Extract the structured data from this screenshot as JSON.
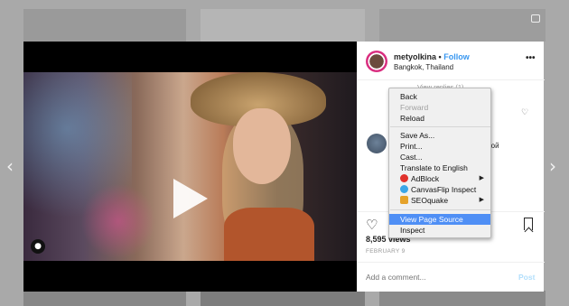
{
  "modal": {
    "username": "metyolkina",
    "separator": "•",
    "follow_label": "Follow",
    "location": "Bangkok, Thailand",
    "more_label": "•••",
    "view_replies": "View replies (1)",
    "partial_comment_line1": "и",
    "partial_comment_line2": "дой",
    "views": "8,595 views",
    "date": "FEBRUARY 9",
    "comment_placeholder": "Add a comment...",
    "post_label": "Post"
  },
  "nav": {
    "prev": "‹",
    "next": "›"
  },
  "context_menu": {
    "items": [
      {
        "label": "Back",
        "disabled": false
      },
      {
        "label": "Forward",
        "disabled": true
      },
      {
        "label": "Reload",
        "disabled": false
      },
      {
        "label": "Save As...",
        "disabled": false
      },
      {
        "label": "Print...",
        "disabled": false
      },
      {
        "label": "Cast...",
        "disabled": false
      },
      {
        "label": "Translate to English",
        "disabled": false
      },
      {
        "label": "AdBlock",
        "icon": "adblock-icon",
        "submenu": true
      },
      {
        "label": "CanvasFlip Inspect",
        "icon": "canvasflip-icon"
      },
      {
        "label": "SEOquake",
        "icon": "seoquake-icon",
        "submenu": true
      },
      {
        "label": "View Page Source",
        "highlighted": true
      },
      {
        "label": "Inspect"
      }
    ],
    "submenu_arrow": "▶"
  },
  "colors": {
    "accent_link": "#3897f0",
    "menu_highlight": "#4f8ff5",
    "post_disabled": "#b2dffc",
    "adblock": "#e0312b",
    "canvasflip": "#3aa6e8",
    "seoquake": "#e5a22a"
  }
}
